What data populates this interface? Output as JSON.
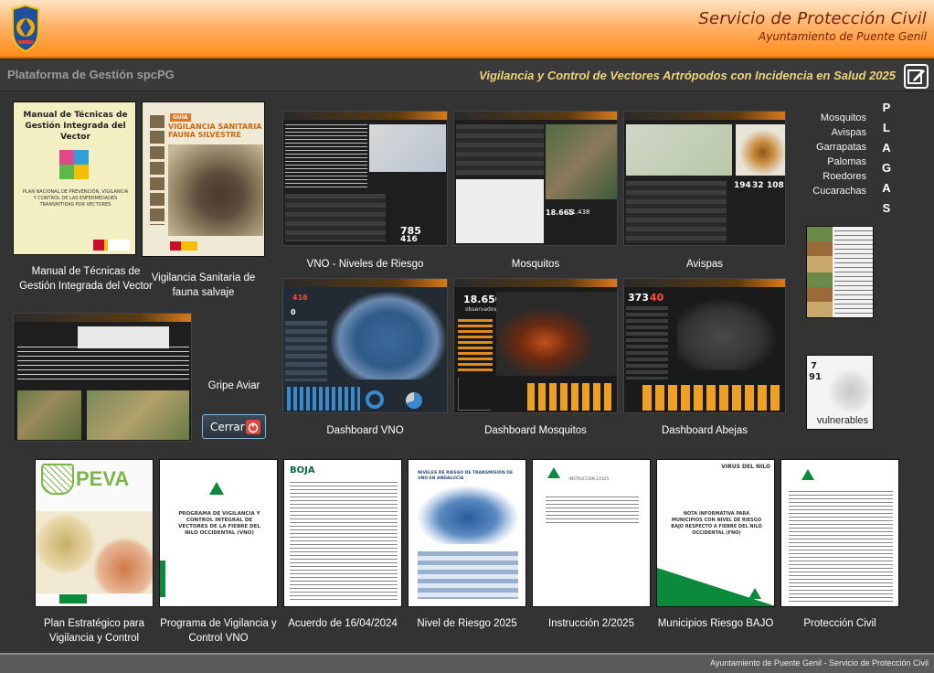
{
  "header": {
    "title": "Servicio de Protección Civil",
    "subtitle": "Ayuntamiento de Puente Genil",
    "logo_text": "PROTECCION CIVIL"
  },
  "titlebar": {
    "platform": "Plataforma de Gestión spcPG",
    "subject": "Vigilancia y Control de Vectores Artrópodos con Incidencia en Salud 2025"
  },
  "documents_top": [
    {
      "caption": "Manual de Técnicas de Gestión Integrada del Vector",
      "cover_title": "Manual de Técnicas de Gestión Integrada del Vector",
      "cover_sub": "PLAN NACIONAL DE PREVENCIÓN, VIGILANCIA Y CONTROL DE LAS ENFERMEDADES TRANSMITIDAS POR VECTORES"
    },
    {
      "caption": "Vigilancia Sanitaria de fauna salvaje",
      "cover_tag": "GUÍA",
      "cover_title": "VIGILANCIA SANITARIA FAUNA SILVESTRE"
    }
  ],
  "gripe_aviar": {
    "caption": "Gripe Aviar"
  },
  "cerrar_button": {
    "label": "Cerrar"
  },
  "dashboards": [
    {
      "caption": "VNO - Niveles de Riesgo",
      "big1": "785",
      "big2": "416"
    },
    {
      "caption": "Mosquitos",
      "big1": "18.665",
      "big2": "11.438"
    },
    {
      "caption": "Avispas",
      "big1": "194",
      "big2": "32",
      "big3": "108"
    },
    {
      "caption": "Dashboard VNO",
      "big1": "416",
      "big2": "0"
    },
    {
      "caption": "Dashboard Mosquitos",
      "big1": "18.650",
      "sub": "observados"
    },
    {
      "caption": "Dashboard Abejas",
      "big1": "373",
      "big2": "40"
    }
  ],
  "plagas": {
    "word": [
      "P",
      "L",
      "A",
      "G",
      "A",
      "S"
    ],
    "items": [
      "Mosquitos",
      "Avispas",
      "Garrapatas",
      "Palomas",
      "Roedores",
      "Cucarachas"
    ]
  },
  "vulnerables": {
    "caption": "vulnerables",
    "n1": "7",
    "n2": "91"
  },
  "documents_bottom": [
    {
      "caption": "Plan Estratégico para Vigilancia y Control",
      "cover_title": "PEVA"
    },
    {
      "caption": "Programa de Vigilancia y Control VNO",
      "cover_title": "PROGRAMA DE VIGILANCIA Y CONTROL INTEGRAL DE VECTORES DE LA FIEBRE DEL NILO OCCIDENTAL (VNO)"
    },
    {
      "caption": "Acuerdo de 16/04/2024",
      "cover_title": "BOJA"
    },
    {
      "caption": "Nivel de Riesgo 2025",
      "cover_title": "NIVELES DE RIESGO DE TRANSMISIÓN DE VNO EN ANDALUCÍA"
    },
    {
      "caption": "Instrucción 2/2025",
      "cover_title": "INSTRUCCIÓN 2/2025"
    },
    {
      "caption": "Municipios Riesgo BAJO",
      "cover_title": "NOTA INFORMATIVA PARA MUNICIPIOS CON NIVEL DE RIESGO BAJO RESPECTO A FIEBRE DEL NILO OCCIDENTAL (FNO)",
      "badge": "VIRUS DEL NILO"
    },
    {
      "caption": "Protección Civil",
      "cover_title": "Protección Civil"
    }
  ],
  "footer": {
    "text": "Ayuntamiento de Puente Genil - Servicio de Protección Civil"
  },
  "colors": {
    "accent": "#ff8c1a",
    "title_text": "#7a1f08",
    "subject_text": "#f0d37a",
    "junta_green": "#0a8a3a"
  }
}
